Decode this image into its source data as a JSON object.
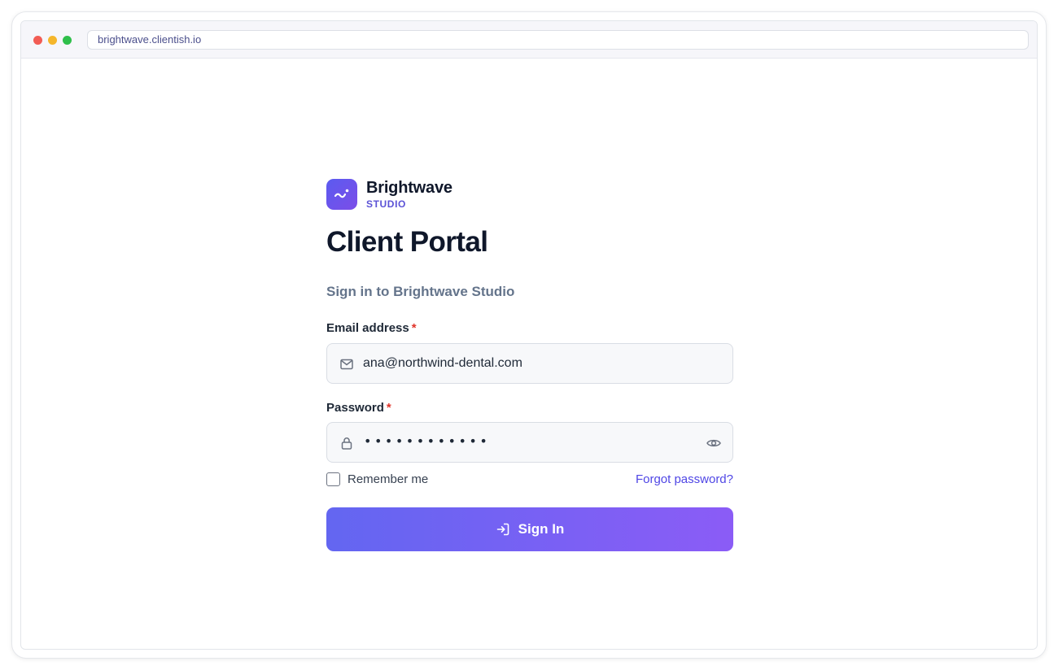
{
  "browser": {
    "url": "brightwave.clientish.io"
  },
  "brand": {
    "name": "Brightwave",
    "tagline": "STUDIO",
    "logo_icon": "wave-icon",
    "accent_color": "#5b52d6"
  },
  "page": {
    "title": "Client Portal",
    "subtitle": "Sign in to Brightwave Studio"
  },
  "form": {
    "email": {
      "label": "Email address",
      "required_marker": "*",
      "value": "ana@northwind-dental.com",
      "icon": "mail-icon"
    },
    "password": {
      "label": "Password",
      "required_marker": "*",
      "masked_value": "••••••••••••",
      "icon": "lock-icon",
      "toggle_icon": "eye-icon"
    },
    "remember_label": "Remember me",
    "remember_checked": false,
    "forgot_label": "Forgot password?",
    "submit_label": "Sign In",
    "submit_icon": "sign-in-icon"
  },
  "colors": {
    "button_gradient_start": "#6366f1",
    "button_gradient_end": "#8b5cf6",
    "required": "#e0352b",
    "link": "#4f46e5"
  }
}
